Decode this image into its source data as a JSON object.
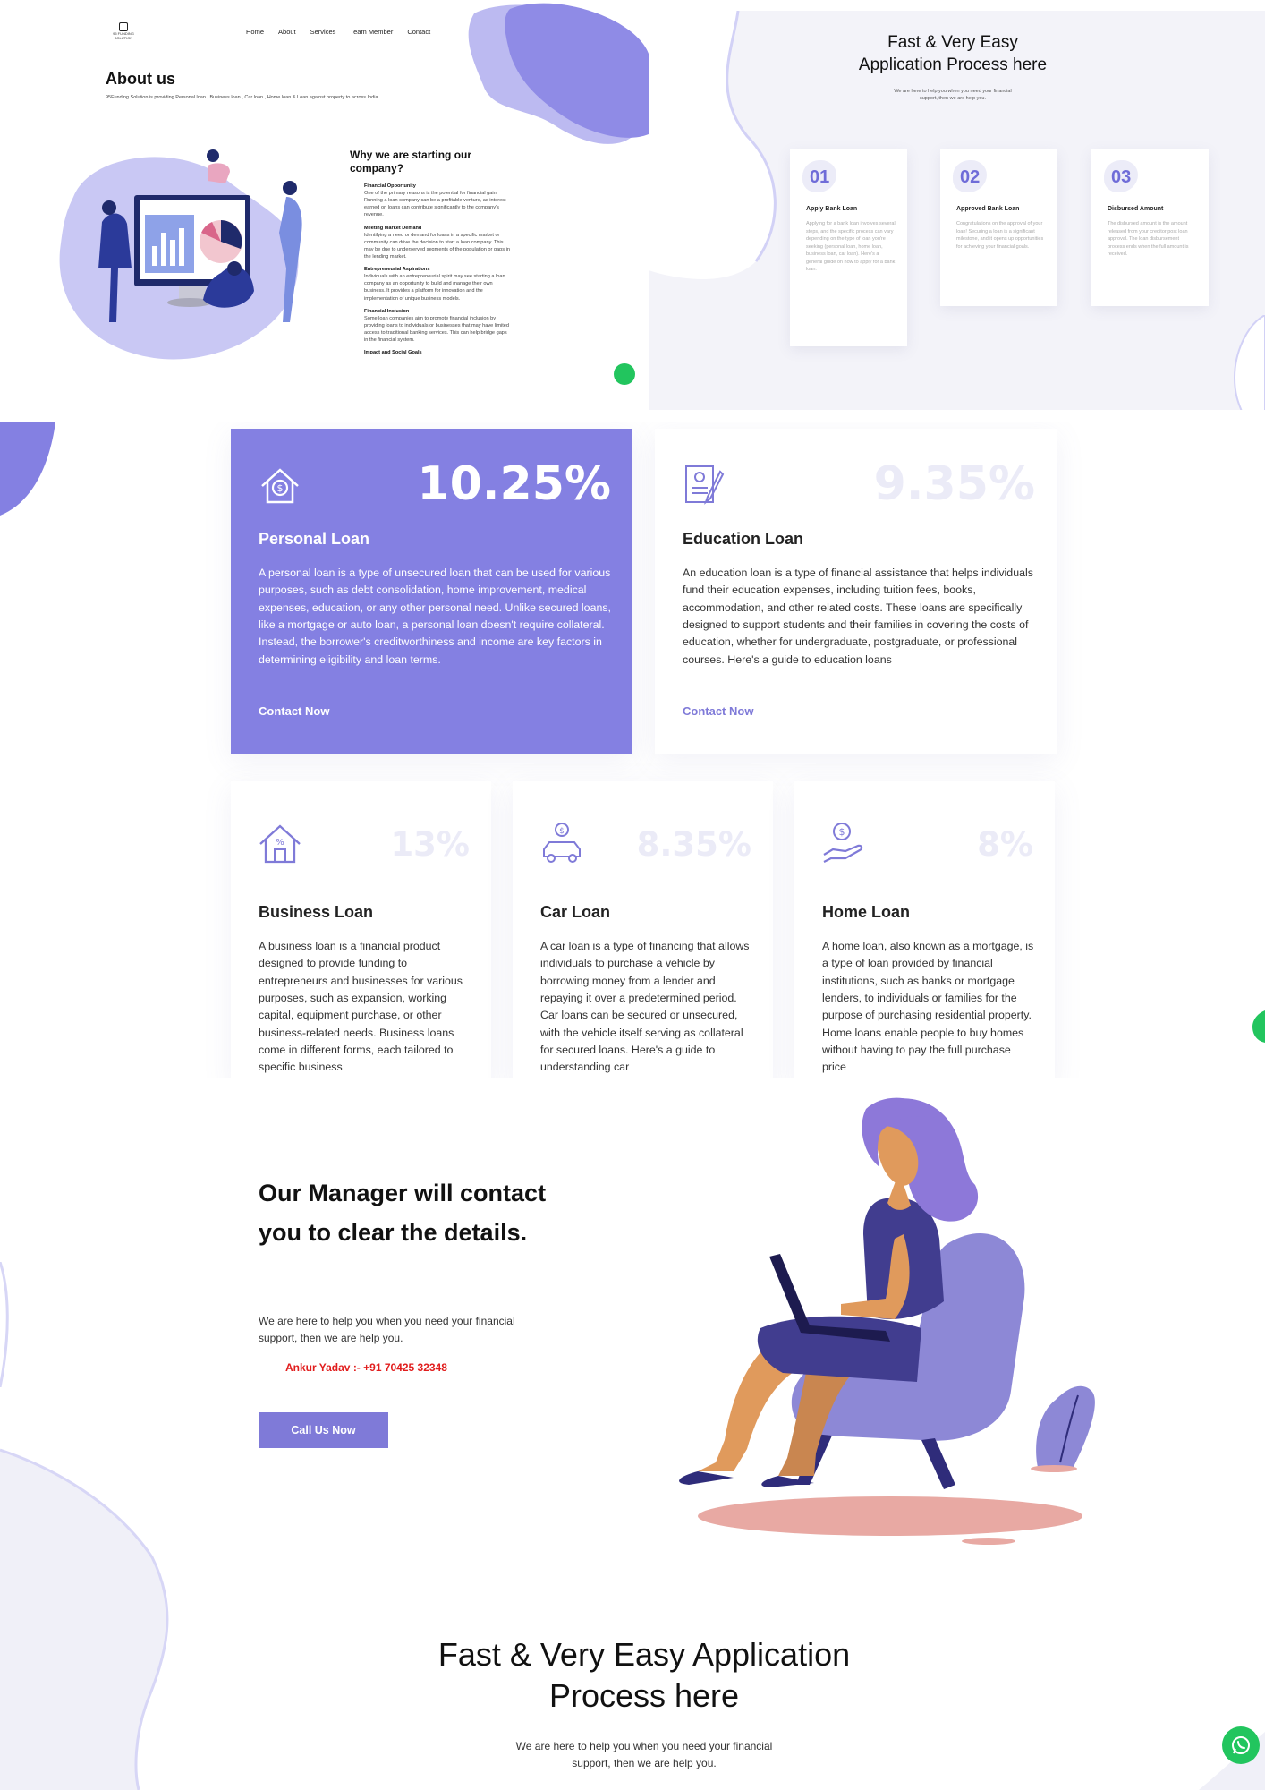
{
  "header": {
    "logo_text": "95 FUNDING SOLUTION",
    "nav": [
      "Home",
      "About",
      "Services",
      "Team Member",
      "Contact"
    ]
  },
  "about": {
    "title": "About us",
    "subtitle": "95Funding Solution is providing Personal loan , Business loan , Car loan , Home loan & Loan against property to across India.",
    "why_title": "Why we are starting our company?",
    "reasons": [
      {
        "heading": "Financial Opportunity",
        "text": "One of the primary reasons is the potential for financial gain. Running a loan company can be a profitable venture, as interest earned on loans can contribute significantly to the company's revenue."
      },
      {
        "heading": "Meeting Market Demand",
        "text": "Identifying a need or demand for loans in a specific market or community can drive the decision to start a loan company. This may be due to underserved segments of the population or gaps in the lending market."
      },
      {
        "heading": "Entrepreneurial Aspirations",
        "text": "Individuals with an entrepreneurial spirit may see starting a loan company as an opportunity to build and manage their own business. It provides a platform for innovation and the implementation of unique business models."
      },
      {
        "heading": "Financial Inclusion",
        "text": "Some loan companies aim to promote financial inclusion by providing loans to individuals or businesses that may have limited access to traditional banking services. This can help bridge gaps in the financial system."
      },
      {
        "heading": "Impact and Social Goals",
        "text": ""
      }
    ]
  },
  "process": {
    "title": "Fast & Very Easy Application Process here",
    "subtitle": "We are here to help you when you need your financial support, then we are help you.",
    "steps": [
      {
        "num": "01",
        "title": "Apply Bank Loan",
        "text": "Applying for a bank loan involves several steps, and the specific process can vary depending on the type of loan you're seeking (personal loan, home loan, business loan, car loan). Here's a general guide on how to apply for a bank loan."
      },
      {
        "num": "02",
        "title": "Approved Bank Loan",
        "text": "Congratulations on the approval of your loan! Securing a loan is a significant milestone, and it opens up opportunities for achieving your financial goals."
      },
      {
        "num": "03",
        "title": "Disbursed Amount",
        "text": "The disbursed amount is the amount released from your creditor post loan approval. The loan disbursement process ends when the full amount is received."
      }
    ]
  },
  "loans": [
    {
      "rate": "10.25%",
      "title": "Personal Loan",
      "text": "A personal loan is a type of unsecured loan that can be used for various purposes, such as debt consolidation, home improvement, medical expenses, education, or any other personal need. Unlike secured loans, like a mortgage or auto loan, a personal loan doesn't require collateral. Instead, the borrower's creditworthiness and income are key factors in determining eligibility and loan terms.",
      "link": "Contact Now",
      "icon": "house-dollar-icon"
    },
    {
      "rate": "9.35%",
      "title": "Education Loan",
      "text": "An education loan is a type of financial assistance that helps individuals fund their education expenses, including tuition fees, books, accommodation, and other related costs. These loans are specifically designed to support students and their families in covering the costs of education, whether for undergraduate, postgraduate, or professional courses. Here's a guide to education loans",
      "link": "Contact Now",
      "icon": "certificate-icon"
    },
    {
      "rate": "13%",
      "title": "Business Loan",
      "text": "A business loan is a financial product designed to provide funding to entrepreneurs and businesses for various purposes, such as expansion, working capital, equipment purchase, or other business-related needs. Business loans come in different forms, each tailored to specific business",
      "icon": "house-percent-icon"
    },
    {
      "rate": "8.35%",
      "title": "Car Loan",
      "text": "A car loan is a type of financing that allows individuals to purchase a vehicle by borrowing money from a lender and repaying it over a predetermined period. Car loans can be secured or unsecured, with the vehicle itself serving as collateral for secured loans. Here's a guide to understanding car",
      "icon": "car-dollar-icon"
    },
    {
      "rate": "8%",
      "title": "Home Loan",
      "text": "A home loan, also known as a mortgage, is a type of loan provided by financial institutions, such as banks or mortgage lenders, to individuals or families for the purpose of purchasing residential property. Home loans enable people to buy homes without having to pay the full purchase price",
      "icon": "hand-dollar-icon"
    }
  ],
  "manager": {
    "title": "Our Manager will contact you to clear the details.",
    "subtitle": "We are here to help you when you need your financial support, then we are help you.",
    "phone": "Ankur Yadav :- +91 70425 32348",
    "button": "Call Us Now"
  },
  "bottom": {
    "title": "Fast & Very Easy Application Process here",
    "subtitle": "We are here to help you when you need your financial support, then we are help you."
  },
  "colors": {
    "accent": "#8480e2",
    "whatsapp": "#22c55e",
    "phone": "#e11d1d"
  }
}
